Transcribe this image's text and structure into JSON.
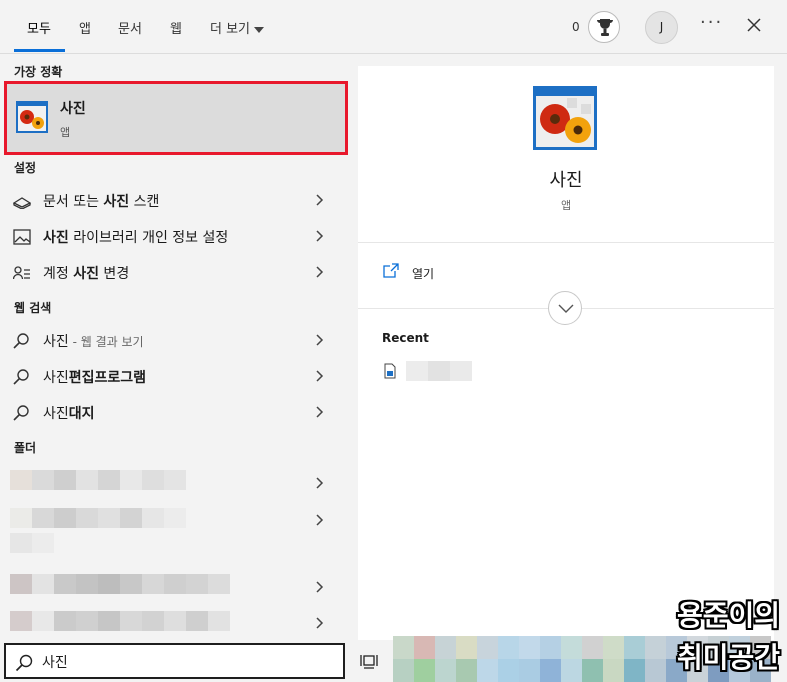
{
  "tabs": [
    {
      "label": "모두",
      "active": true
    },
    {
      "label": "앱"
    },
    {
      "label": "문서"
    },
    {
      "label": "웹"
    },
    {
      "label": "더 보기"
    }
  ],
  "header": {
    "points": "0",
    "avatar_initial": "J",
    "more_label": "···"
  },
  "best_match": {
    "section_label": "가장 정확",
    "name": "사진",
    "sub": "앱"
  },
  "settings": {
    "section_label": "설정",
    "items": [
      {
        "pre": "문서 또는 ",
        "bold": "사진",
        "post": " 스캔",
        "icon": "scanner-icon"
      },
      {
        "pre": "",
        "bold": "사진",
        "post": " 라이브러리 개인 정보 설정",
        "icon": "image-icon"
      },
      {
        "pre": "계정 ",
        "bold": "사진",
        "post": " 변경",
        "icon": "person-list-icon"
      }
    ]
  },
  "web": {
    "section_label": "웹 검색",
    "items": [
      {
        "pre": "사진",
        "bold": "",
        "suffix": " - 웹 결과 보기",
        "icon": "search-icon"
      },
      {
        "pre": "사진",
        "bold": "편집프로그램",
        "suffix": "",
        "icon": "search-icon"
      },
      {
        "pre": "사진",
        "bold": "대지",
        "suffix": "",
        "icon": "search-icon"
      }
    ]
  },
  "folders": {
    "section_label": "폴더"
  },
  "detail": {
    "title": "사진",
    "sub": "앱",
    "open_label": "열기",
    "recent_label": "Recent"
  },
  "search": {
    "value": "사진"
  },
  "watermark": {
    "line1": "용준이의",
    "line2": "취미공간"
  },
  "colors": {
    "accent": "#0a6fd8",
    "highlight": "#e8182c"
  }
}
